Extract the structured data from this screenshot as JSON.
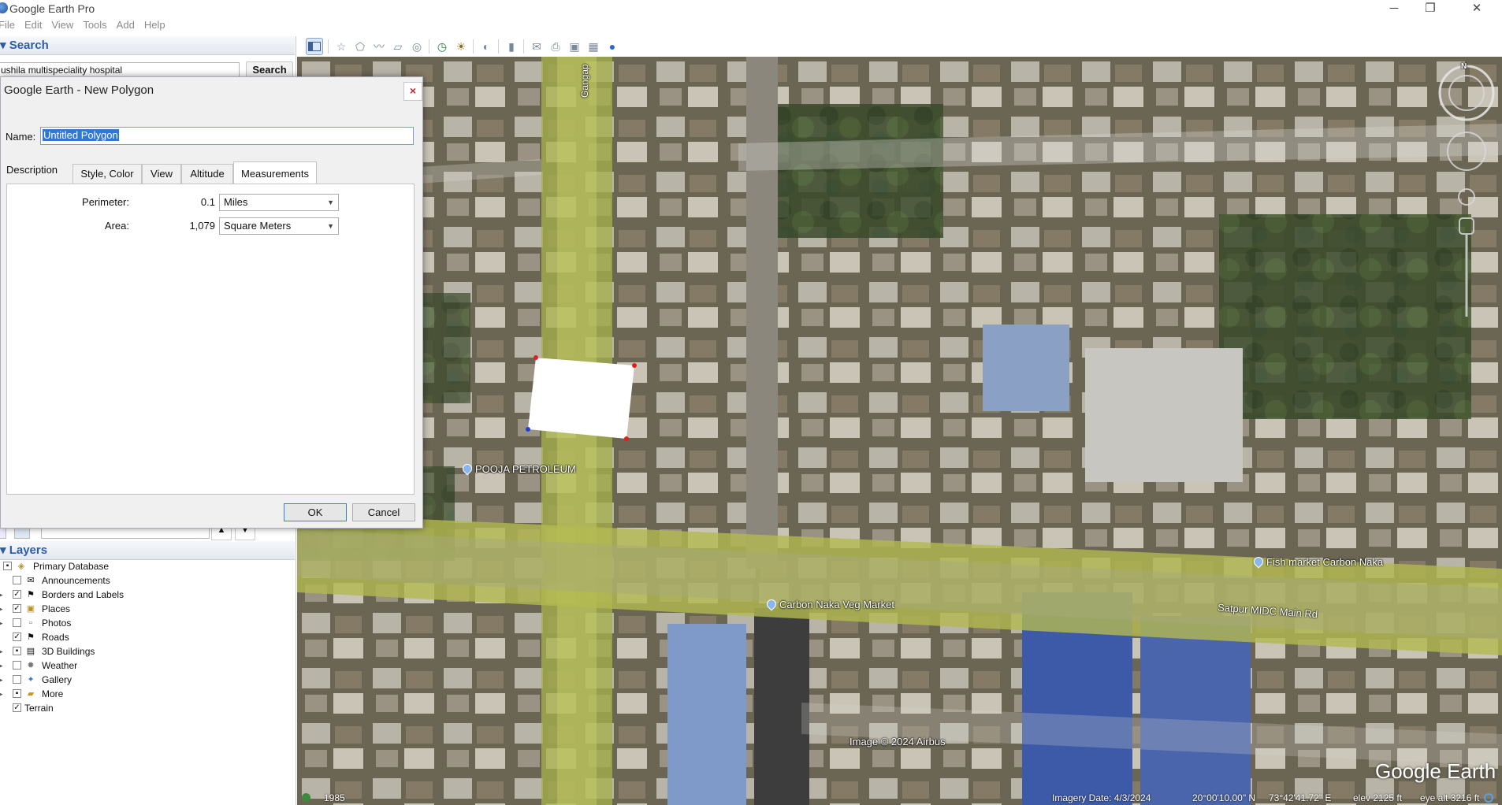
{
  "window": {
    "title": "Google Earth Pro",
    "controls": {
      "minimize": "─",
      "restore": "❐",
      "close": "✕"
    }
  },
  "menu": [
    "File",
    "Edit",
    "View",
    "Tools",
    "Add",
    "Help"
  ],
  "search": {
    "header": "Search",
    "header_arrow": "▾",
    "query": "ushila multispeciality hospital",
    "button": "Search"
  },
  "layers": {
    "header": "Layers",
    "header_arrow": "▾",
    "items": [
      {
        "label": "Primary Database",
        "checked": "partial",
        "expander": ""
      },
      {
        "label": "Announcements",
        "checked": "none",
        "expander": ""
      },
      {
        "label": "Borders and Labels",
        "checked": "yes",
        "expander": "▸"
      },
      {
        "label": "Places",
        "checked": "yes",
        "expander": "▸"
      },
      {
        "label": "Photos",
        "checked": "none",
        "expander": "▸"
      },
      {
        "label": "Roads",
        "checked": "yes",
        "expander": ""
      },
      {
        "label": "3D Buildings",
        "checked": "partial",
        "expander": "▸"
      },
      {
        "label": "Weather",
        "checked": "none",
        "expander": "▸"
      },
      {
        "label": "Gallery",
        "checked": "none",
        "expander": "▸"
      },
      {
        "label": "More",
        "checked": "partial",
        "expander": "▸"
      },
      {
        "label": "Terrain",
        "checked": "yes",
        "expander": ""
      }
    ]
  },
  "dialog": {
    "title": "Google Earth - New Polygon",
    "close": "×",
    "name_label": "Name:",
    "name_value": "Untitled Polygon",
    "tabs": [
      "Description",
      "Style, Color",
      "View",
      "Altitude",
      "Measurements"
    ],
    "active_tab": "Measurements",
    "perimeter": {
      "label": "Perimeter:",
      "value": "0.1",
      "unit": "Miles"
    },
    "area": {
      "label": "Area:",
      "value": "1,079",
      "unit": "Square Meters"
    },
    "ok": "OK",
    "cancel": "Cancel"
  },
  "map": {
    "labels": {
      "road_vertical": "Gangap",
      "pooja": "POOJA PETROLEUM",
      "fish_market": "Fish market Carbon Naka",
      "veg_market": "Carbon Naka Veg Market",
      "satpur": "Satpur MIDC Main Rd",
      "copyright": "Image © 2024 Airbus",
      "brand": "Google Earth"
    },
    "compass_n": "N",
    "status": {
      "year": "1985",
      "imagery_date": "Imagery Date: 4/3/2024",
      "lat": "20°00'10.00\" N",
      "lon": "73°42'41.72\" E",
      "elev": "elev  2125 ft",
      "eye_alt": "eye alt  3216 ft"
    }
  },
  "colors": {
    "polygon_fill": "#ffffff",
    "vertex_red": "#e02020",
    "vertex_blue": "#2040e0",
    "header_blue": "#2d5ca6",
    "road_highlight": "#b6c24a"
  }
}
